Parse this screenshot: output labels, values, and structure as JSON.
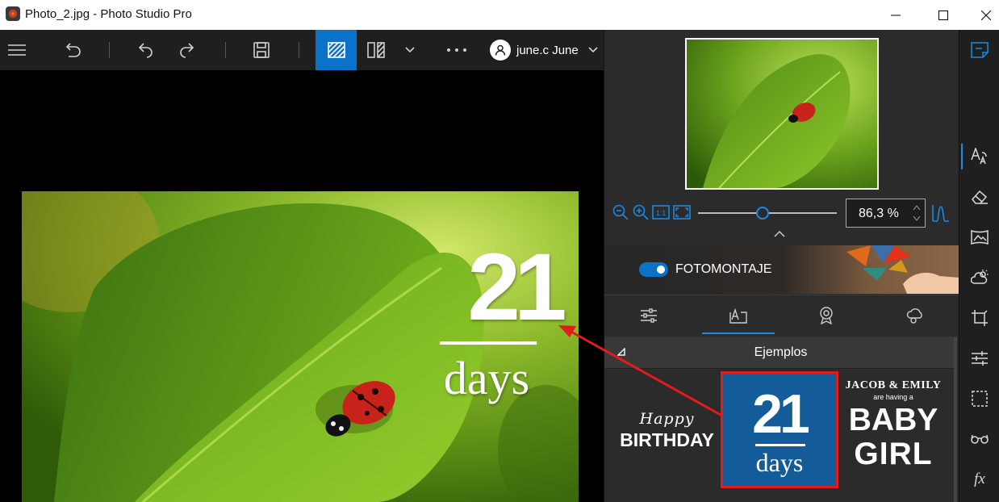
{
  "window": {
    "title": "Photo_2.jpg - Photo Studio Pro"
  },
  "toolbar": {
    "user_name": "june.c June",
    "active_tool": "split-view-compare"
  },
  "canvas": {
    "photo_text_number": "21",
    "photo_text_word": "days"
  },
  "navigator": {
    "zoom_value": "86,3 %",
    "zoom_level_percent": 86.3
  },
  "montage": {
    "label": "FOTOMONTAJE",
    "enabled": true
  },
  "tabs": [
    "adjust-sliders",
    "text-frame",
    "badge",
    "cloud-shapes"
  ],
  "examples": {
    "header": "Ejemplos",
    "items": {
      "birthday": {
        "line1": "Happy",
        "line2": "BIRTHDAY"
      },
      "days": {
        "number": "21",
        "word": "days"
      },
      "baby": {
        "line1": "JACOB & EMILY",
        "line2": "are having a",
        "line3": "BABY",
        "line4": "GIRL"
      }
    }
  },
  "colors": {
    "accent": "#0a72c8",
    "highlight_border": "#e21b1b",
    "example_bg": "#135b99"
  }
}
